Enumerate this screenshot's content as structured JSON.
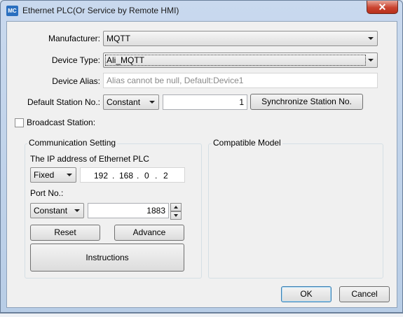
{
  "window": {
    "icon_text": "MC",
    "title": "Ethernet PLC(Or Service by Remote HMI)",
    "close_glyph": "✕"
  },
  "form": {
    "manufacturer_label": "Manufacturer:",
    "manufacturer_value": "MQTT",
    "device_type_label": "Device Type:",
    "device_type_value": "Ali_MQTT",
    "device_alias_label": "Device Alias:",
    "device_alias_placeholder": "Alias cannot be null, Default:Device1",
    "default_station_label": "Default Station No.:",
    "station_mode_value": "Constant",
    "station_number_value": "1",
    "sync_button_label": "Synchronize Station No.",
    "broadcast_label": "Broadcast Station:"
  },
  "communication": {
    "group_title": "Communication Setting",
    "ip_label": "The IP address of Ethernet PLC",
    "ip_mode_value": "Fixed",
    "ip_parts": [
      "192",
      "168",
      "0",
      "2"
    ],
    "ip_dot": ".",
    "port_label": "Port No.:",
    "port_mode_value": "Constant",
    "port_value": "1883",
    "reset_label": "Reset",
    "advance_label": "Advance",
    "instructions_label": "Instructions"
  },
  "compatible": {
    "group_title": "Compatible Model"
  },
  "footer": {
    "ok_label": "OK",
    "cancel_label": "Cancel"
  }
}
